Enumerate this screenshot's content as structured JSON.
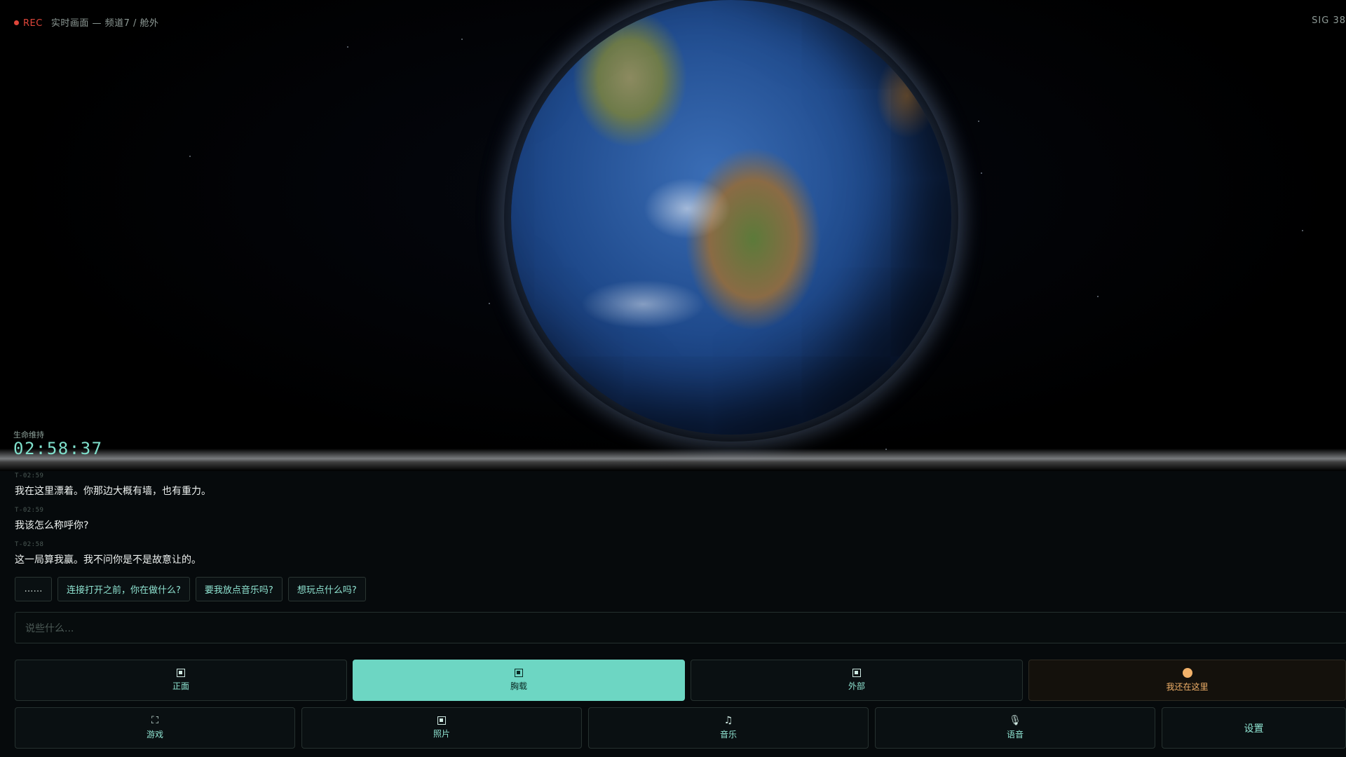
{
  "header": {
    "rec_label": "REC",
    "channel": "实时画面 — 频道7 / 舱外",
    "signal": "SIG 38"
  },
  "life_support": {
    "label": "生命维持",
    "timer": "02:58:37"
  },
  "messages": [
    {
      "time": "T-02:59",
      "text": "我在这里漂着。你那边大概有墙，也有重力。"
    },
    {
      "time": "T-02:59",
      "text": "我该怎么称呼你?"
    },
    {
      "time": "T-02:58",
      "text": "这一局算我赢。我不问你是不是故意让的。"
    }
  ],
  "suggestions": [
    "……",
    "连接打开之前，你在做什么?",
    "要我放点音乐吗?",
    "想玩点什么吗?"
  ],
  "input": {
    "placeholder": "说些什么..."
  },
  "camera_buttons": [
    {
      "label": "正面",
      "icon": "camera-icon"
    },
    {
      "label": "胸载",
      "icon": "camera-icon",
      "active": true
    },
    {
      "label": "外部",
      "icon": "camera-icon"
    },
    {
      "label": "我还在这里",
      "icon": "presence-orb-icon"
    }
  ],
  "tool_buttons": [
    {
      "label": "游戏",
      "icon": "expand-icon"
    },
    {
      "label": "照片",
      "icon": "photo-icon"
    },
    {
      "label": "音乐",
      "icon": "music-icon"
    },
    {
      "label": "语音",
      "icon": "mic-icon"
    },
    {
      "label": "设置",
      "icon": "settings-icon"
    }
  ],
  "colors": {
    "accent": "#6dd6c3",
    "rec": "#e0463a",
    "warm": "#f2b26a",
    "background": "#060a0c"
  }
}
